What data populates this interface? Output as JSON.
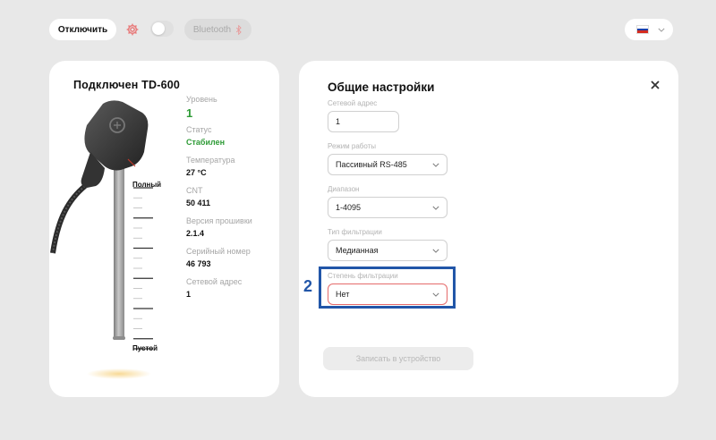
{
  "toolbar": {
    "disconnect_label": "Отключить",
    "bluetooth_label": "Bluetooth"
  },
  "device": {
    "title": "Подключен  TD-600",
    "scale_full": "Полный",
    "scale_empty": "Пустой",
    "info": [
      {
        "label": "Уровень",
        "value": "1"
      },
      {
        "label": "Статус",
        "value": "Стабилен"
      },
      {
        "label": "Температура",
        "value": "27 °C"
      },
      {
        "label": "CNT",
        "value": "50 411"
      },
      {
        "label": "Версия прошивки",
        "value": "2.1.4"
      },
      {
        "label": "Серийный номер",
        "value": "46 793"
      },
      {
        "label": "Сетевой адрес",
        "value": "1"
      }
    ]
  },
  "settings": {
    "title": "Общие настройки",
    "network_address": {
      "label": "Сетевой адрес",
      "value": "1"
    },
    "mode": {
      "label": "Режим работы",
      "value": "Пассивный RS-485"
    },
    "range": {
      "label": "Диапазон",
      "value": "1-4095"
    },
    "filter_type": {
      "label": "Тип фильтрации",
      "value": "Медианная"
    },
    "filter_degree": {
      "label": "Степень фильтрации",
      "value": "Нет"
    },
    "submit_label": "Записать в устройство"
  },
  "annotation": {
    "number": "2"
  },
  "colors": {
    "background": "#e8e8e8",
    "accent_green": "#2e9b36",
    "highlight_blue": "#2256a8",
    "error_border": "#e56b6b"
  },
  "icons": [
    "gear-icon",
    "bluetooth-icon",
    "flag-ru-icon",
    "chevron-down-icon",
    "close-icon"
  ]
}
